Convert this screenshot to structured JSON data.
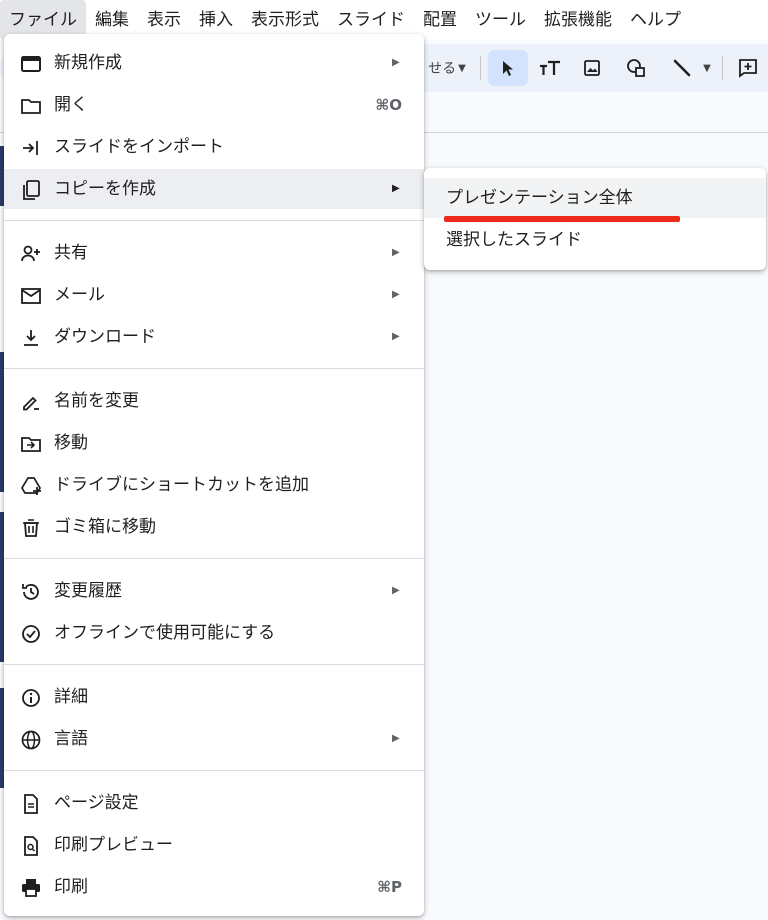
{
  "menubar": [
    "ファイル",
    "編集",
    "表示",
    "挿入",
    "表示形式",
    "スライド",
    "配置",
    "ツール",
    "拡張機能",
    "ヘルプ"
  ],
  "toolbar": {
    "partial_label": "せる"
  },
  "file_menu": {
    "items": [
      {
        "label": "新規作成",
        "icon": "presentation-icon",
        "arrow": "▶"
      },
      {
        "label": "開く",
        "icon": "folder-icon",
        "shortcut": "⌘O"
      },
      {
        "label": "スライドをインポート",
        "icon": "import-icon"
      },
      {
        "label": "コピーを作成",
        "icon": "copy-icon",
        "arrow": "▶"
      },
      {
        "label": "共有",
        "icon": "person-add-icon",
        "arrow": "▶"
      },
      {
        "label": "メール",
        "icon": "mail-icon",
        "arrow": "▶"
      },
      {
        "label": "ダウンロード",
        "icon": "download-icon",
        "arrow": "▶"
      },
      {
        "label": "名前を変更",
        "icon": "rename-icon"
      },
      {
        "label": "移動",
        "icon": "move-folder-icon"
      },
      {
        "label": "ドライブにショートカットを追加",
        "icon": "drive-add-icon"
      },
      {
        "label": "ゴミ箱に移動",
        "icon": "trash-icon"
      },
      {
        "label": "変更履歴",
        "icon": "history-icon",
        "arrow": "▶"
      },
      {
        "label": "オフラインで使用可能にする",
        "icon": "offline-icon"
      },
      {
        "label": "詳細",
        "icon": "info-icon"
      },
      {
        "label": "言語",
        "icon": "globe-icon",
        "arrow": "▶"
      },
      {
        "label": "ページ設定",
        "icon": "page-icon"
      },
      {
        "label": "印刷プレビュー",
        "icon": "print-preview-icon"
      },
      {
        "label": "印刷",
        "icon": "print-icon",
        "shortcut": "⌘P"
      }
    ]
  },
  "copy_submenu": {
    "items": [
      "プレゼンテーション全体",
      "選択したスライド"
    ]
  },
  "colors": {
    "accent_underline": "#ee2a1b",
    "selected_tool": "#d3e3fd"
  }
}
